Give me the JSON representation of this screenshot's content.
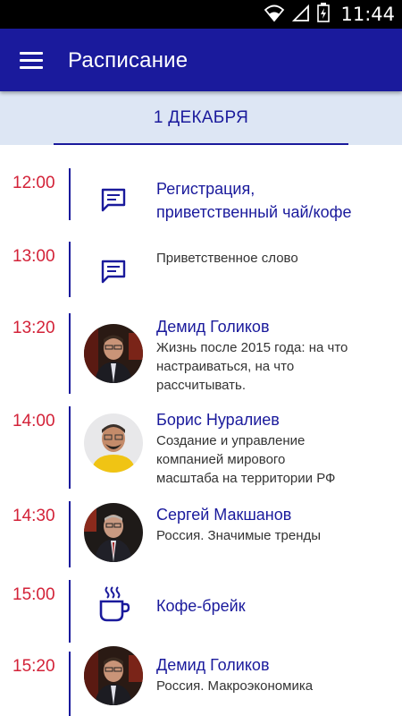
{
  "status_bar": {
    "time": "11:44",
    "icons": [
      "wifi-icon",
      "signal-icon",
      "battery-icon"
    ]
  },
  "app_bar": {
    "title": "Расписание",
    "menu_icon": "hamburger-menu-icon"
  },
  "tabs": [
    {
      "label": "1 ДЕКАБРЯ",
      "selected": true
    }
  ],
  "colors": {
    "primary": "#1a1a9c",
    "time_red": "#d32238",
    "tab_bg": "#dde6f4",
    "text": "#333333"
  },
  "schedule": [
    {
      "time": "12:00",
      "icon": "chat-icon",
      "name": "Регистрация,",
      "name2": "приветственный чай/кофе",
      "desc": ""
    },
    {
      "time": "13:00",
      "icon": "chat-icon",
      "name": "",
      "desc": "Приветственное слово"
    },
    {
      "time": "13:20",
      "icon": "avatar",
      "name": "Демид Голиков",
      "desc": "Жизнь после 2015 года: на что",
      "desc2": "настраиваться, на что",
      "desc3": "рассчитывать."
    },
    {
      "time": "14:00",
      "icon": "avatar",
      "name": "Борис Нуралиев",
      "desc": "Создание и управление",
      "desc2": "компанией мирового",
      "desc3": "масштаба на территории РФ"
    },
    {
      "time": "14:30",
      "icon": "avatar",
      "name": "Сергей Макшанов",
      "desc": "Россия. Значимые тренды"
    },
    {
      "time": "15:00",
      "icon": "coffee-cup-icon",
      "name": "Кофе-брейк",
      "desc": ""
    },
    {
      "time": "15:20",
      "icon": "avatar",
      "name": "Демид Голиков",
      "desc": "Россия. Макроэкономика"
    }
  ]
}
